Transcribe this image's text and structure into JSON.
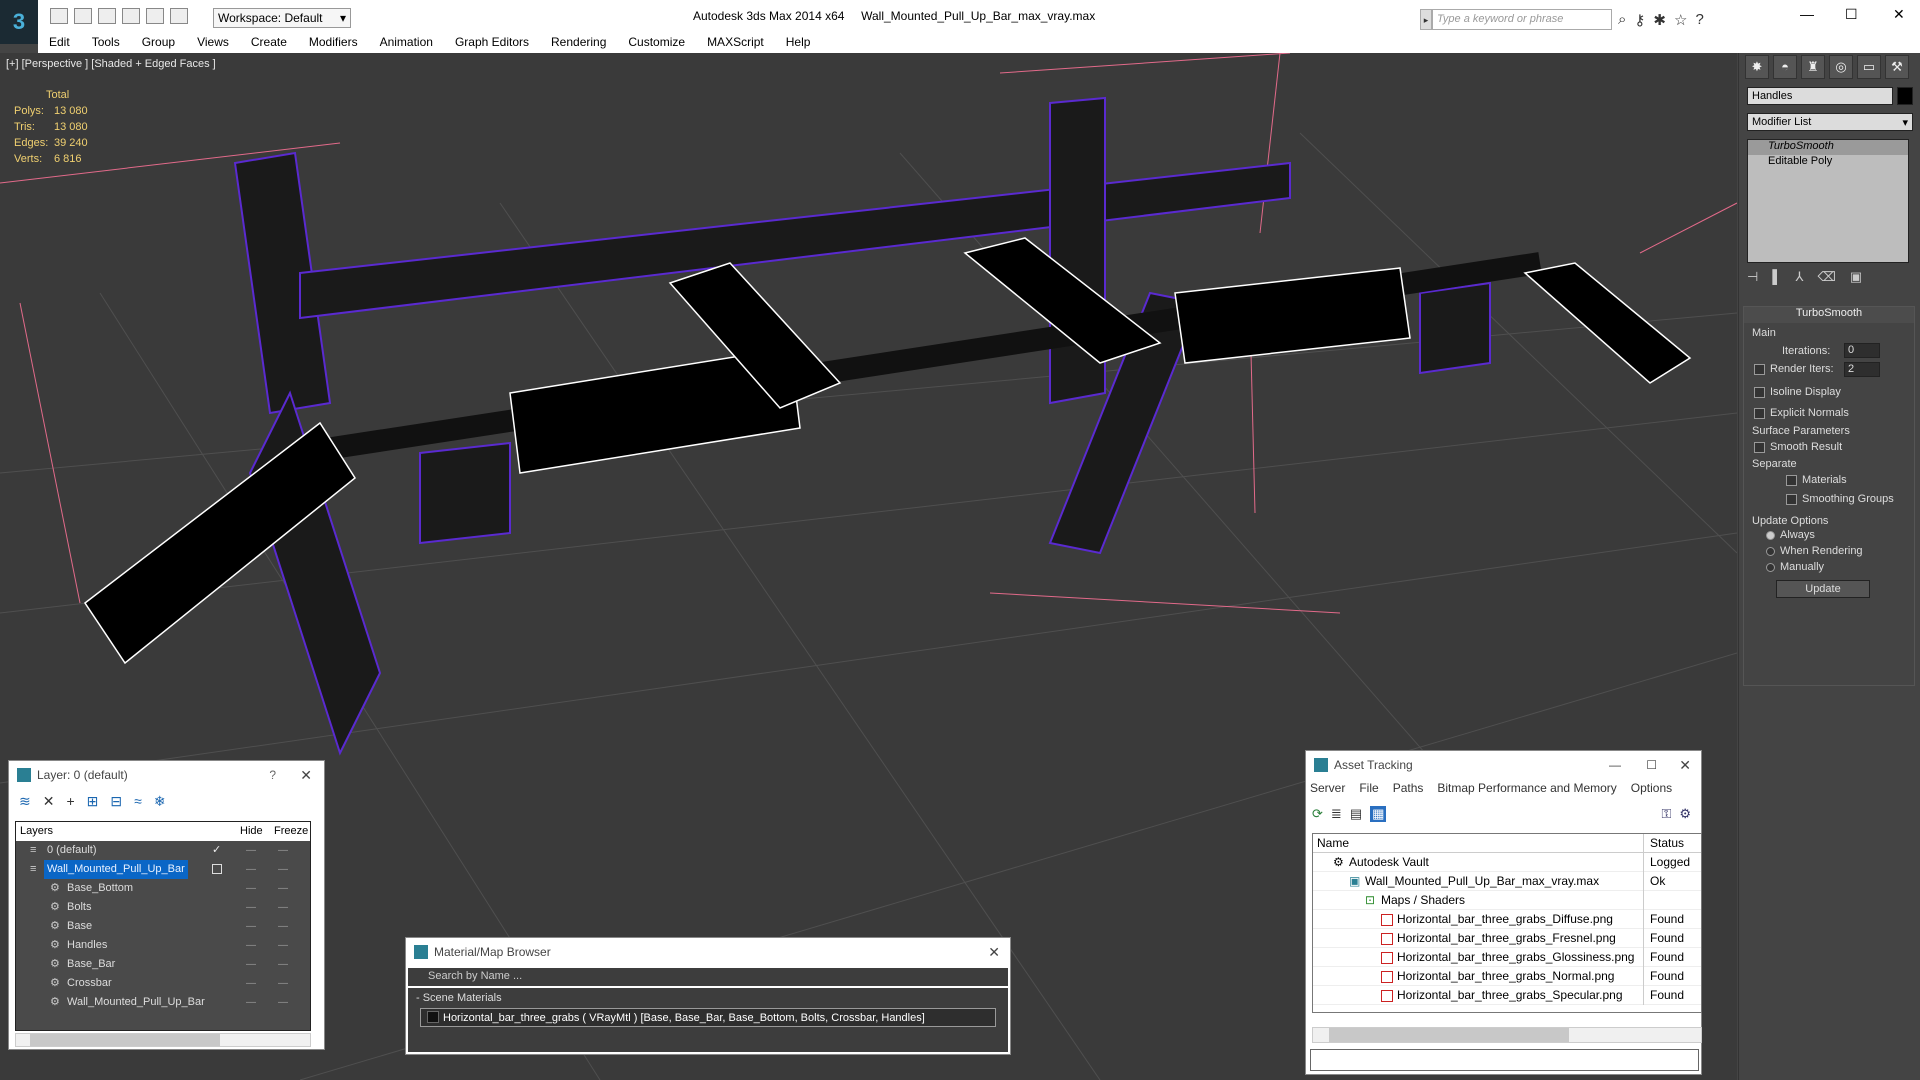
{
  "app": {
    "title": "Autodesk 3ds Max  2014 x64",
    "file": "Wall_Mounted_Pull_Up_Bar_max_vray.max",
    "workspace": "Workspace: Default",
    "search_placeholder": "Type a keyword or phrase"
  },
  "menu": [
    "Edit",
    "Tools",
    "Group",
    "Views",
    "Create",
    "Modifiers",
    "Animation",
    "Graph Editors",
    "Rendering",
    "Customize",
    "MAXScript",
    "Help"
  ],
  "viewport": {
    "label": "[+] [Perspective ] [Shaded + Edged Faces ]",
    "stats_header": "Total",
    "stats": [
      {
        "k": "Polys:",
        "v": "13 080"
      },
      {
        "k": "Tris:",
        "v": "13 080"
      },
      {
        "k": "Edges:",
        "v": "39 240"
      },
      {
        "k": "Verts:",
        "v": "6 816"
      }
    ]
  },
  "cmd": {
    "object_name": "Handles",
    "modifier_list": "Modifier List",
    "stack": [
      "TurboSmooth",
      "Editable Poly"
    ],
    "turbo": {
      "title": "TurboSmooth",
      "main": "Main",
      "iterations_label": "Iterations:",
      "iterations": "0",
      "render_iters_label": "Render Iters:",
      "render_iters": "2",
      "isoline": "Isoline Display",
      "explicit": "Explicit Normals",
      "surface": "Surface Parameters",
      "smooth": "Smooth Result",
      "separate": "Separate",
      "materials": "Materials",
      "smoothing": "Smoothing Groups",
      "update_opts": "Update Options",
      "always": "Always",
      "when_rendering": "When Rendering",
      "manually": "Manually",
      "update": "Update"
    }
  },
  "layers": {
    "title": "Layer: 0 (default)",
    "help": "?",
    "col_layers": "Layers",
    "col_hide": "Hide",
    "col_freeze": "Freeze",
    "rows": [
      "0 (default)",
      "Wall_Mounted_Pull_Up_Bar",
      "Base_Bottom",
      "Bolts",
      "Base",
      "Handles",
      "Base_Bar",
      "Crossbar",
      "Wall_Mounted_Pull_Up_Bar"
    ]
  },
  "material": {
    "title": "Material/Map Browser",
    "search": "Search by Name ...",
    "section": "- Scene Materials",
    "item": "Horizontal_bar_three_grabs ( VRayMtl ) [Base, Base_Bar, Base_Bottom, Bolts, Crossbar, Handles]"
  },
  "asset": {
    "title": "Asset Tracking",
    "menu": [
      "Server",
      "File",
      "Paths",
      "Bitmap Performance and Memory",
      "Options"
    ],
    "col_name": "Name",
    "col_status": "Status",
    "rows": [
      {
        "n": "Autodesk Vault",
        "s": "Logged Ou",
        "indent": 20
      },
      {
        "n": "Wall_Mounted_Pull_Up_Bar_max_vray.max",
        "s": "Ok",
        "indent": 36
      },
      {
        "n": "Maps / Shaders",
        "s": "",
        "indent": 52
      },
      {
        "n": "Horizontal_bar_three_grabs_Diffuse.png",
        "s": "Found",
        "indent": 68
      },
      {
        "n": "Horizontal_bar_three_grabs_Fresnel.png",
        "s": "Found",
        "indent": 68
      },
      {
        "n": "Horizontal_bar_three_grabs_Glossiness.png",
        "s": "Found",
        "indent": 68
      },
      {
        "n": "Horizontal_bar_three_grabs_Normal.png",
        "s": "Found",
        "indent": 68
      },
      {
        "n": "Horizontal_bar_three_grabs_Specular.png",
        "s": "Found",
        "indent": 68
      }
    ]
  }
}
